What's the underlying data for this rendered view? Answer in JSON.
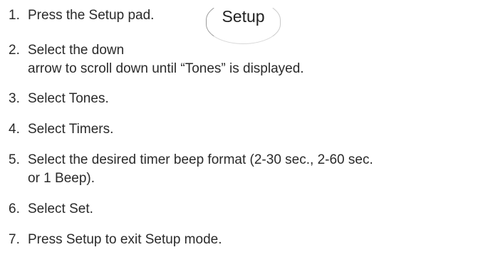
{
  "pad": {
    "label": "Setup"
  },
  "steps": [
    {
      "number": "1.",
      "lines": [
        "Press the Setup pad."
      ]
    },
    {
      "number": "2.",
      "lines": [
        "Select the down",
        "arrow to scroll down until “Tones” is displayed."
      ]
    },
    {
      "number": "3.",
      "lines": [
        "Select Tones."
      ]
    },
    {
      "number": "4.",
      "lines": [
        "Select Timers."
      ]
    },
    {
      "number": "5.",
      "lines": [
        "Select the desired timer beep format (2-30 sec., 2-60 sec.",
        "or 1 Beep)."
      ]
    },
    {
      "number": "6.",
      "lines": [
        "Select Set."
      ]
    },
    {
      "number": "7.",
      "lines": [
        "Press Setup to exit Setup mode."
      ]
    }
  ]
}
